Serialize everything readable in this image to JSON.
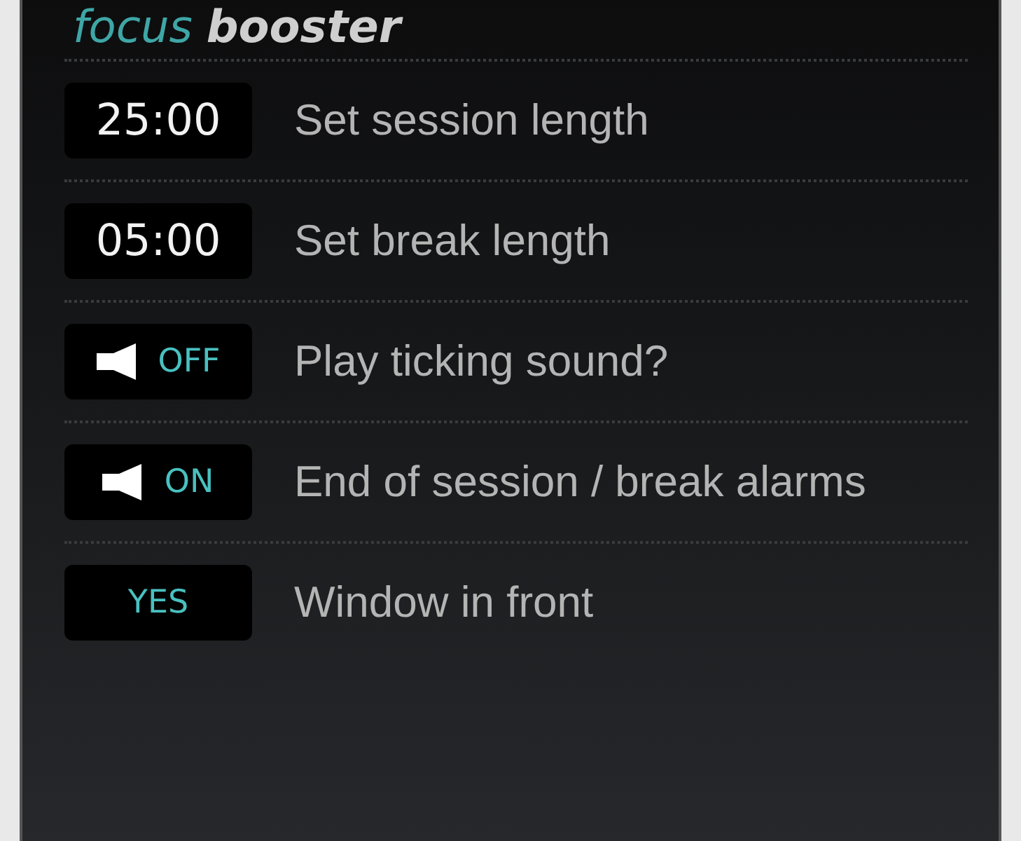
{
  "title": {
    "brand": "focus",
    "product": "booster"
  },
  "settings": [
    {
      "kind": "time",
      "value": "25:00",
      "label": "Set session length"
    },
    {
      "kind": "time",
      "value": "05:00",
      "label": "Set break length"
    },
    {
      "kind": "sound",
      "value": "OFF",
      "label": "Play ticking sound?"
    },
    {
      "kind": "sound",
      "value": "ON",
      "label": "End of session / break alarms"
    },
    {
      "kind": "toggle",
      "value": "YES",
      "label": "Window in front"
    }
  ]
}
